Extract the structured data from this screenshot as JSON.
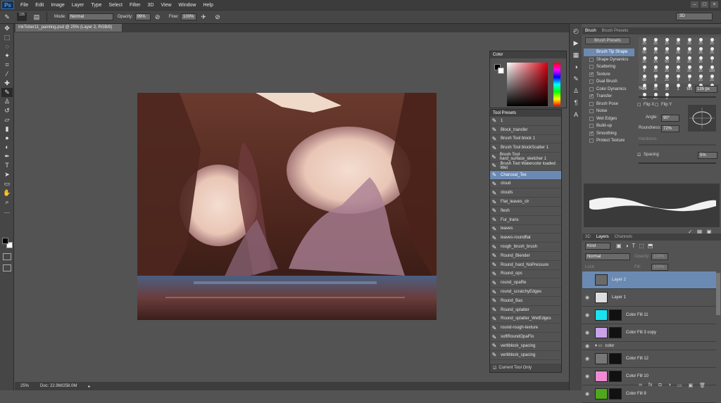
{
  "app": {
    "logo": "Ps"
  },
  "menu": [
    "File",
    "Edit",
    "Image",
    "Layer",
    "Type",
    "Select",
    "Filter",
    "3D",
    "View",
    "Window",
    "Help"
  ],
  "options": {
    "brush_size": "135",
    "mode_label": "Mode:",
    "mode_value": "Normal",
    "opacity_label": "Opacity:",
    "opacity_value": "99%",
    "flow_label": "Flow:",
    "flow_value": "100%"
  },
  "workspace": "3D",
  "document": {
    "tab": "InkTober11_painting.psd @ 25% (Layer 2, RGB/8)"
  },
  "status": {
    "zoom": "25%",
    "doc": "Doc: 22.9M/258.0M"
  },
  "color_panel": {
    "tab": "Color"
  },
  "tool_presets": {
    "tab": "Tool Presets",
    "items": [
      "1",
      "Block_transfer",
      "Brush Tool block 1",
      "Brush Tool blockScatter 1",
      "Brush Tool hard_surface_sketcher 1",
      "Brush Tool Watercolor loaded Wet",
      "Charcoal_Tex",
      "cloud",
      "clouds",
      "Flat_leaves_clr",
      "flesh",
      "Fur_trans",
      "leaves",
      "leaves-roundflat",
      "rough_brush_brush",
      "Round_Blender",
      "Round_hard_NoPressure",
      "Round_ops",
      "round_opaRe",
      "round_scratchyEdges",
      "Round_Bas",
      "Round_splatter",
      "Round_splatter_WetEdges",
      "round-rough-texture",
      "softRoundOpaFlo",
      "vertiblock_spacing",
      "vertiblock_spacing"
    ],
    "selected": 6,
    "footer": "Current Tool Only"
  },
  "brush_panel": {
    "tabs": [
      "Brush",
      "Brush Presets"
    ],
    "presets_button": "Brush Presets",
    "options": [
      {
        "label": "Brush Tip Shape",
        "checked": false,
        "highlight": true
      },
      {
        "label": "Shape Dynamics",
        "checked": false
      },
      {
        "label": "Scattering",
        "checked": false
      },
      {
        "label": "Texture",
        "checked": true
      },
      {
        "label": "Dual Brush",
        "checked": false
      },
      {
        "label": "Color Dynamics",
        "checked": false
      },
      {
        "label": "Transfer",
        "checked": true
      },
      {
        "label": "Brush Pose",
        "checked": false
      },
      {
        "label": "Noise",
        "checked": false
      },
      {
        "label": "Wet Edges",
        "checked": false
      },
      {
        "label": "Build-up",
        "checked": false
      },
      {
        "label": "Smoothing",
        "checked": true
      },
      {
        "label": "Protect Texture",
        "checked": false
      }
    ],
    "tip_sizes": [
      "25",
      "25",
      "25",
      "25",
      "25",
      "25",
      "25",
      "50",
      "25",
      "25",
      "25",
      "25",
      "25",
      "25",
      "25",
      "25",
      "50",
      "25",
      "25",
      "25",
      "3",
      "9",
      "25",
      "25",
      "25",
      "25",
      "25",
      "100",
      "60",
      "5",
      "25",
      "9",
      "9",
      "25",
      "25",
      "25",
      "25",
      "30",
      "3",
      "135",
      "282",
      "170",
      "16",
      "25",
      "6"
    ],
    "size_label": "Size",
    "size_value": "135 px",
    "flipx": "Flip X",
    "flipy": "Flip Y",
    "angle_label": "Angle:",
    "angle_value": "90°",
    "roundness_label": "Roundness:",
    "roundness_value": "72%",
    "hardness_label": "Hardness",
    "spacing_label": "Spacing",
    "spacing_value": "5%"
  },
  "layers_panel": {
    "tabs": [
      "3D",
      "Layers",
      "Channels"
    ],
    "kind": "Kind",
    "blend": "Normal",
    "opacity_label": "Opacity:",
    "opacity_value": "100%",
    "lock_label": "Lock:",
    "fill_label": "Fill:",
    "fill_value": "100%",
    "layers": [
      {
        "name": "Layer 2",
        "selected": true,
        "thumb": "#6a6a6a"
      },
      {
        "name": "Layer 1",
        "selected": false,
        "thumb": "#dedede"
      },
      {
        "name": "Color Fill 11",
        "selected": false,
        "thumb": "#19e3ee"
      },
      {
        "name": "Color Fill 3 copy",
        "selected": false,
        "thumb": "#c9a2e8"
      },
      {
        "name": "color",
        "selected": false,
        "group": true
      },
      {
        "name": "Color Fill 12",
        "selected": false,
        "thumb": "#777777"
      },
      {
        "name": "Color Fill 10",
        "selected": false,
        "thumb": "#ee8bd5"
      },
      {
        "name": "Color Fill 9",
        "selected": false,
        "thumb": "#4fa81c"
      }
    ]
  },
  "colors": {
    "accent": "#6b8ab3",
    "bg": "#535353",
    "panel": "#464646"
  }
}
